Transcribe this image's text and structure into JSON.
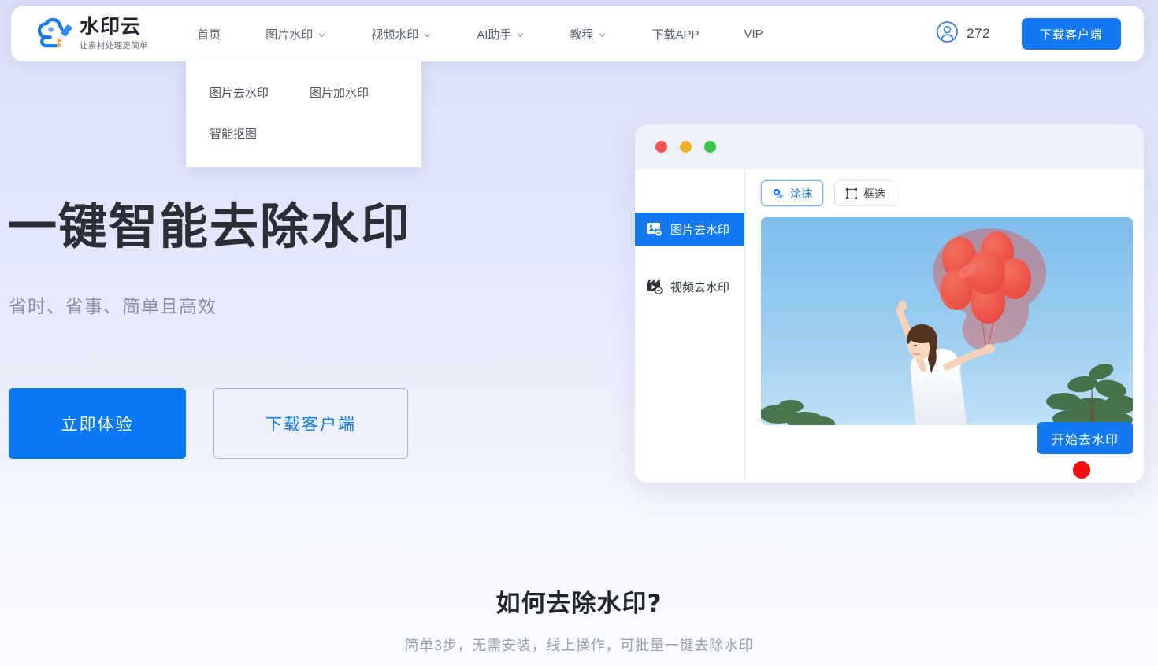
{
  "brand": {
    "name": "水印云",
    "tagline": "让素材处理更简单",
    "logo_icon": "cloud-eraser-logo-icon",
    "accent_color": "#1279f2"
  },
  "header": {
    "nav": [
      {
        "label": "首页",
        "has_caret": false,
        "name": "nav-home"
      },
      {
        "label": "图片水印",
        "has_caret": true,
        "name": "nav-image-watermark"
      },
      {
        "label": "视频水印",
        "has_caret": true,
        "name": "nav-video-watermark"
      },
      {
        "label": "AI助手",
        "has_caret": true,
        "name": "nav-ai-assistant"
      },
      {
        "label": "教程",
        "has_caret": true,
        "name": "nav-tutorial"
      },
      {
        "label": "下载APP",
        "has_caret": false,
        "name": "nav-download-app"
      },
      {
        "label": "VIP",
        "has_caret": false,
        "name": "nav-vip"
      }
    ],
    "user": {
      "icon": "user-avatar-icon",
      "count": "272"
    },
    "download_button": "下载客户端"
  },
  "dropdown": {
    "open_for": "图片水印",
    "items": [
      {
        "label": "图片去水印",
        "highlighted": true
      },
      {
        "label": "图片加水印",
        "highlighted": false
      },
      {
        "label": "智能抠图",
        "highlighted": false
      }
    ],
    "highlight_color": "#f21a1a"
  },
  "hero": {
    "title": "一键智能去除水印",
    "subtitle": "省时、省事、简单且高效",
    "primary_cta": "立即体验",
    "secondary_cta": "下载客户端"
  },
  "mockup": {
    "window_dots": [
      "red",
      "yellow",
      "green"
    ],
    "sidebar": [
      {
        "label": "图片去水印",
        "icon": "image-remove-watermark-icon",
        "active": true
      },
      {
        "label": "视频去水印",
        "icon": "video-remove-watermark-icon",
        "active": false
      }
    ],
    "tools": [
      {
        "label": "涂抹",
        "icon": "brush-smear-icon",
        "active": true
      },
      {
        "label": "框选",
        "icon": "marquee-select-icon",
        "active": false
      }
    ],
    "preview_alt": "woman-holding-red-balloons-photo",
    "start_button": "开始去水印"
  },
  "section": {
    "title": "如何去除水印?",
    "subtitle": "简单3步，无需安装，线上操作，可批量一键去除水印"
  }
}
